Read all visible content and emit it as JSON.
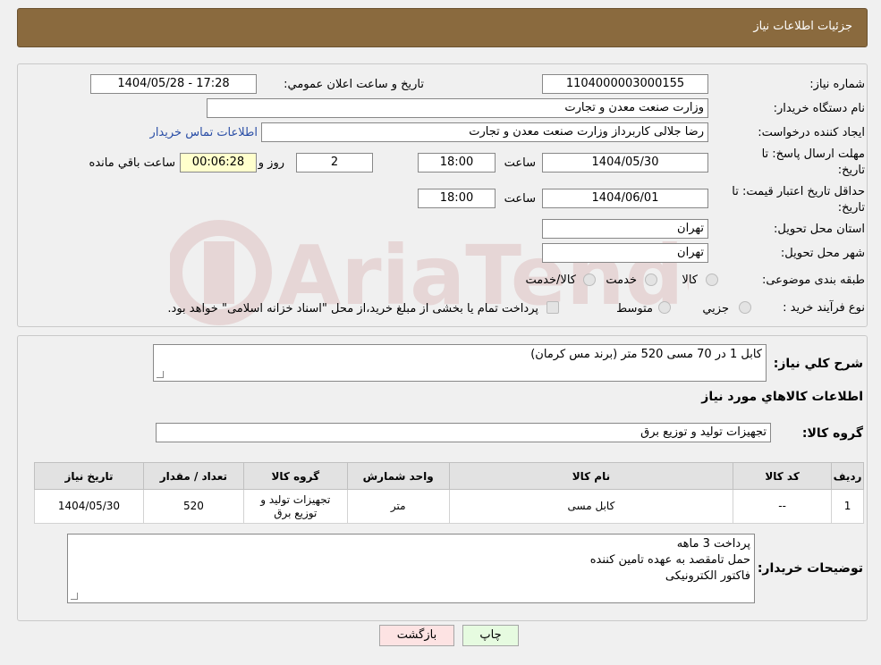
{
  "header": {
    "title": "جزئيات اطلاعات نياز"
  },
  "form": {
    "need_number_label": "شماره نياز:",
    "need_number": "1104000003000155",
    "announce_label": "تاريخ و ساعت اعلان عمومي:",
    "announce_value": "1404/05/28 - 17:28",
    "buyer_org_label": "نام دستگاه خريدار:",
    "buyer_org": "وزارت صنعت معدن و تجارت",
    "requester_label": "ايجاد کننده درخواست:",
    "requester": "رضا جلالی کاربرداز وزارت صنعت معدن و تجارت",
    "contact_link": "اطلاعات تماس خريدار",
    "deadline_label_1": "مهلت ارسال پاسخ: تا",
    "deadline_label_2": "تاريخ:",
    "deadline_date": "1404/05/30",
    "time_label": "ساعت",
    "deadline_time": "18:00",
    "days_value": "2",
    "days_label": "روز و",
    "remaining_value": "00:06:28",
    "remaining_label": "ساعت باقي مانده",
    "validity_label_1": "حداقل تاريخ اعتبار قيمت: تا",
    "validity_label_2": "تاريخ:",
    "validity_date": "1404/06/01",
    "validity_time": "18:00",
    "province_label": "استان محل تحويل:",
    "province": "تهران",
    "city_label": "شهر محل تحويل:",
    "city": "تهران",
    "category_label": "طبقه بندی موضوعی:",
    "category_options": [
      "کالا",
      "خدمت",
      "کالا/خدمت"
    ],
    "process_label": "نوع فرآيند خريد :",
    "process_options": [
      "جزيي",
      "متوسط"
    ],
    "process_note": "پرداخت تمام يا بخشی از مبلغ خريد،از محل \"اسناد خزانه اسلامی\" خواهد بود."
  },
  "description": {
    "label": "شرح کلي نياز:",
    "text": "کابل 1 در 70 مسی 520 متر (برند مس کرمان)",
    "goods_heading": "اطلاعات کالاهاي مورد نياز",
    "group_label": "گروه کالا:",
    "group_value": "تجهيزات توليد و توزيع برق"
  },
  "table": {
    "headers": [
      "رديف",
      "کد کالا",
      "نام کالا",
      "واحد شمارش",
      "گروه کالا",
      "تعداد / مقدار",
      "تاريخ نياز"
    ],
    "rows": [
      [
        "1",
        "--",
        "کابل مسی",
        "متر",
        "تجهيزات توليد و توزيع برق",
        "520",
        "1404/05/30"
      ]
    ]
  },
  "buyer_notes": {
    "label": "توضيحات خريدار:",
    "lines": [
      "پرداخت 3 ماهه",
      "حمل تامقصد به عهده تامين کننده",
      "فاکتور الکترونيکی"
    ]
  },
  "buttons": {
    "print": "چاپ",
    "back": "بازگشت"
  },
  "colors": {
    "header_bg": "#8a6a3e",
    "link": "#2a4ea6",
    "remaining_bg": "#ffffcc",
    "back_bg": "#fde3e3",
    "print_bg": "#e6fbe0"
  }
}
